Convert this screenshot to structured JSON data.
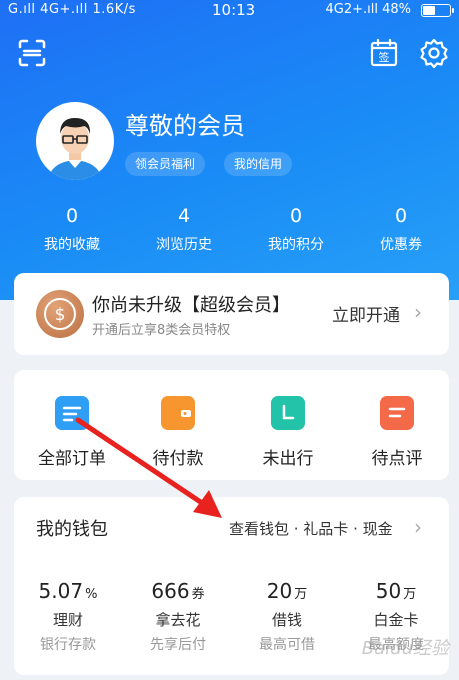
{
  "status_bar": {
    "signal_left": "G.ıll 4G+.ıll",
    "speed": "1.6K/s",
    "time": "10:13",
    "network_right": "4G2+.ıll",
    "battery": "48%"
  },
  "header": {
    "scan_icon": "scan-icon",
    "sign_label": "签",
    "settings_icon": "gear-icon"
  },
  "profile": {
    "name": "尊敬的会员",
    "tags": [
      "领会员福利",
      "我的信用"
    ]
  },
  "stats": [
    {
      "value": "0",
      "label": "我的收藏"
    },
    {
      "value": "4",
      "label": "浏览历史"
    },
    {
      "value": "0",
      "label": "我的积分"
    },
    {
      "value": "0",
      "label": "优惠券"
    }
  ],
  "upgrade": {
    "title": "你尚未升级【超级会员】",
    "subtitle": "开通后立享8类会员特权",
    "button": "立即开通"
  },
  "orders": [
    {
      "label": "全部订单",
      "color": "#2f9ff5"
    },
    {
      "label": "待付款",
      "color": "#f7962e"
    },
    {
      "label": "未出行",
      "color": "#22c3a8"
    },
    {
      "label": "待点评",
      "color": "#f46a48"
    }
  ],
  "wallet": {
    "title": "我的钱包",
    "links": "查看钱包 · 礼品卡 · 现金",
    "items": [
      {
        "value": "5.07",
        "unit": "%",
        "name": "理财",
        "desc": "银行存款"
      },
      {
        "value": "666",
        "unit": "券",
        "name": "拿去花",
        "desc": "先享后付"
      },
      {
        "value": "20",
        "unit": "万",
        "name": "借钱",
        "desc": "最高可借"
      },
      {
        "value": "50",
        "unit": "万",
        "name": "白金卡",
        "desc": "最高额度"
      }
    ]
  },
  "watermark": "Baidu经验"
}
